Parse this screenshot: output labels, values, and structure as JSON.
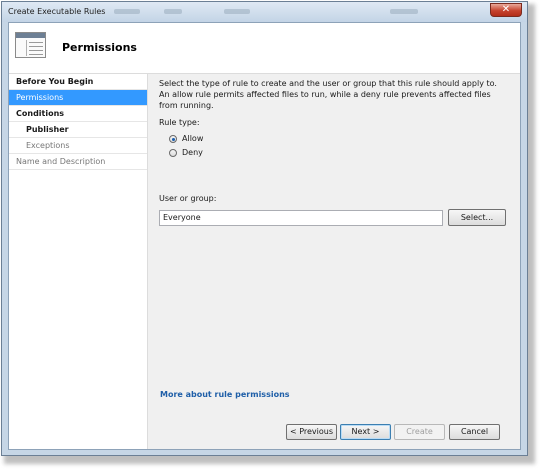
{
  "window": {
    "title": "Create Executable Rules",
    "close_symbol": "✕"
  },
  "header": {
    "title": "Permissions",
    "icon": "wizard-page-icon"
  },
  "sidebar": {
    "items": [
      {
        "label": "Before You Begin"
      },
      {
        "label": "Permissions"
      },
      {
        "label": "Conditions"
      },
      {
        "label": "Publisher"
      },
      {
        "label": "Exceptions"
      },
      {
        "label": "Name and Description"
      }
    ]
  },
  "main": {
    "description": "Select the type of rule to create and the user or group that this rule should apply to. An allow rule permits affected files to run, while a deny rule prevents affected files from running.",
    "rule_type_label": "Rule type:",
    "rule_options": [
      {
        "label": "Allow",
        "selected": true
      },
      {
        "label": "Deny",
        "selected": false
      }
    ],
    "user_group_label": "User or group:",
    "user_group_value": "Everyone",
    "select_button": "Select...",
    "more_link": "More about rule permissions"
  },
  "footer": {
    "previous": "< Previous",
    "next": "Next >",
    "create": "Create",
    "cancel": "Cancel"
  },
  "colors": {
    "selection": "#3399ff",
    "link": "#1f5fa8"
  }
}
